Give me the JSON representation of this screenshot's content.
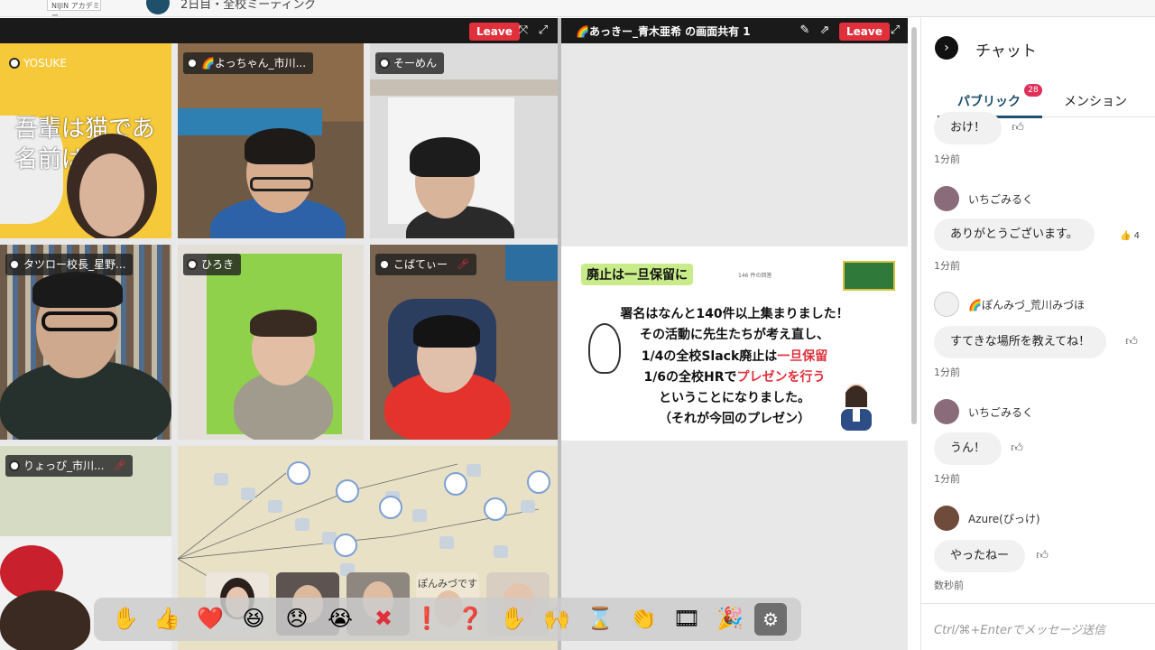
{
  "app": {
    "logo_text": "NIJIN アカデミー",
    "room_title": "2日目・全校ミーティング"
  },
  "grid": {
    "leave_label": "Leave",
    "tiles": [
      {
        "name": "YOSUKE",
        "bg_text_1": "吾輩は猫であ",
        "bg_text_2": "名前は",
        "muted": false
      },
      {
        "name": "🌈よっちゃん_市川...",
        "muted": false
      },
      {
        "name": "そーめん",
        "muted": false
      },
      {
        "name": "タツロー校長_星野...",
        "muted": false
      },
      {
        "name": "ひろき",
        "muted": false
      },
      {
        "name": "こばてぃー",
        "muted": true
      },
      {
        "name": "りょっぴ_市川...",
        "muted": true
      }
    ]
  },
  "share": {
    "title": "🌈あっきー_青木亜希 の画面共有 1",
    "leave_label": "Leave",
    "slide": {
      "tag": "廃止は一旦保留に",
      "count_label": "146 件の回答",
      "line1": "署名はなんと140件以上集まりました！",
      "line2": "その活動に先生たちが考え直し、",
      "line3a": "1/4の全校Slack廃止は",
      "line3b": "一旦保留",
      "line4a": "1/6の全校HRで",
      "line4b": "プレゼンを行う",
      "line5": "ということになりました。",
      "line6": "（それが今回のプレゼン）"
    }
  },
  "chat": {
    "title": "チャット",
    "tabs": [
      {
        "label": "パブリック",
        "badge": "28"
      },
      {
        "label": "メンション"
      }
    ],
    "messages": [
      {
        "user": "",
        "text": "おけ！",
        "time": "1分前"
      },
      {
        "user": "いちごみるく",
        "text": "ありがとうございます。",
        "reaction": "👍 4",
        "time": "1分前"
      },
      {
        "user": "🌈ぽんみづ_荒川みづほ",
        "text": "すてきな場所を教えてね！",
        "time": "1分前"
      },
      {
        "user": "いちごみるく",
        "text": "うん！",
        "time": "1分前"
      },
      {
        "user": "Azure(ぴっけ)",
        "text": "やったねー",
        "time": "数秒前"
      }
    ],
    "input_placeholder": "Ctrl/⌘+Enterでメッセージ送信"
  },
  "tray": {
    "reactions": [
      "✋",
      "👍",
      "❤️",
      "😆",
      "😞",
      "😭",
      "✖",
      "❗",
      "❓",
      "✋",
      "🙌",
      "⌛",
      "👏",
      "🎞",
      "🎉"
    ],
    "thumb_caption": "ぽんみづです"
  },
  "colors": {
    "leave": "#e0303b",
    "accent": "#1e4f6b",
    "badge": "#e0305a",
    "slide_tag": "#c9ec8a"
  }
}
